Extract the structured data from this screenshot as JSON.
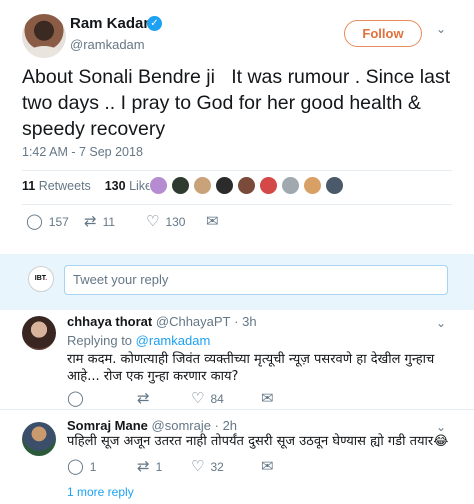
{
  "tweet": {
    "author_name": "Ram Kadam",
    "author_handle": "@ramkadam",
    "follow_label": "Follow",
    "text": "About Sonali Bendre ji   It was rumour . Since last two days .. I pray to God for her good health & speedy recovery",
    "timestamp": "1:42 AM - 7 Sep 2018",
    "retweets_count": "11",
    "retweets_label": "Retweets",
    "likes_count": "130",
    "likes_label": "Likes",
    "reply_count": "157",
    "retweet_count": "11",
    "like_count": "130"
  },
  "reply_box": {
    "logo_text": "IBT",
    "placeholder": "Tweet your reply"
  },
  "replies": [
    {
      "name": "chhaya thorat",
      "handle": "@ChhayaPT",
      "time": "3h",
      "replying_prefix": "Replying to",
      "replying_to": "@ramkadam",
      "text": "राम कदम. कोणत्याही जिवंत व्यक्तीच्या मृत्यूची न्यूज़ पसरवणे हा देखील गुन्हाच आहे... रोज एक गुन्हा करणार काय?",
      "reply_count": "",
      "retweet_count": "",
      "like_count": "84"
    },
    {
      "name": "Somraj Mane",
      "handle": "@somraje",
      "time": "2h",
      "text": "पहिली सूज अजून उतरत नाही तोपर्यंत दुसरी सूज उठवून घेण्यास ह्यो गडी तयार😂",
      "reply_count": "1",
      "retweet_count": "1",
      "like_count": "32"
    }
  ],
  "more_replies": "1 more reply",
  "colors": {
    "accent": "#1da1f2",
    "follow": "#e0703c",
    "muted": "#657786",
    "reply_bg": "#e8f5fd"
  }
}
